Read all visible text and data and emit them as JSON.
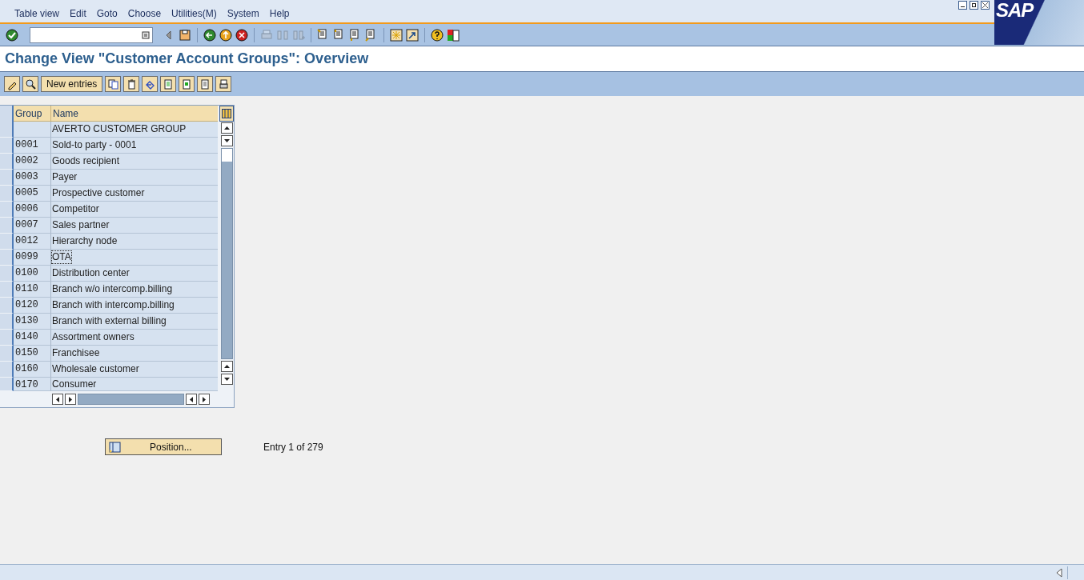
{
  "menu_bar": {
    "items": [
      "Table view",
      "Edit",
      "Goto",
      "Choose",
      "Utilities(M)",
      "System",
      "Help"
    ]
  },
  "logo": {
    "text": "SAP"
  },
  "title": "Change View \"Customer Account Groups\": Overview",
  "app_toolbar": {
    "new_entries_button": "New entries"
  },
  "table": {
    "columns": [
      "Group",
      "Name"
    ],
    "rows": [
      {
        "group": "",
        "name": "AVERTO CUSTOMER GROUP",
        "focused": false
      },
      {
        "group": "0001",
        "name": "Sold-to party - 0001",
        "focused": false
      },
      {
        "group": "0002",
        "name": "Goods recipient",
        "focused": false
      },
      {
        "group": "0003",
        "name": "Payer",
        "focused": false
      },
      {
        "group": "0005",
        "name": "Prospective customer",
        "focused": false
      },
      {
        "group": "0006",
        "name": "Competitor",
        "focused": false
      },
      {
        "group": "0007",
        "name": "Sales partner",
        "focused": false
      },
      {
        "group": "0012",
        "name": "Hierarchy node",
        "focused": false
      },
      {
        "group": "0099",
        "name": "OTA",
        "focused": true
      },
      {
        "group": "0100",
        "name": "Distribution center",
        "focused": false
      },
      {
        "group": "0110",
        "name": "Branch w/o intercomp.billing",
        "focused": false
      },
      {
        "group": "0120",
        "name": "Branch with intercomp.billing",
        "focused": false
      },
      {
        "group": "0130",
        "name": "Branch with external billing",
        "focused": false
      },
      {
        "group": "0140",
        "name": "Assortment owners",
        "focused": false
      },
      {
        "group": "0150",
        "name": "Franchisee",
        "focused": false
      },
      {
        "group": "0160",
        "name": "Wholesale customer",
        "focused": false
      },
      {
        "group": "0170",
        "name": "Consumer",
        "focused": false
      }
    ]
  },
  "position_button": "Position...",
  "entry_info": "Entry 1 of 279"
}
